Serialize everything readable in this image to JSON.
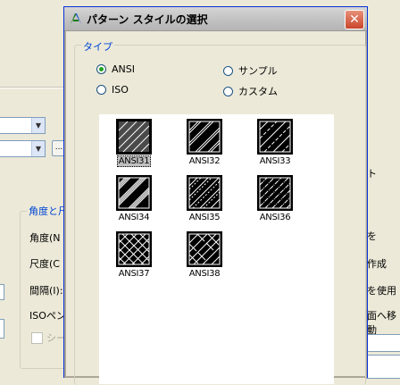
{
  "dialog": {
    "title": "パターン スタイルの選択",
    "close_symbol": "✕",
    "group_label": "タイプ",
    "radios": [
      {
        "label": "ANSI",
        "selected": true
      },
      {
        "label": "ISO",
        "selected": false
      },
      {
        "label": "サンプル",
        "selected": false
      },
      {
        "label": "カスタム",
        "selected": false
      }
    ],
    "patterns": [
      {
        "label": "ANSI31",
        "selected": true
      },
      {
        "label": "ANSI32",
        "selected": false
      },
      {
        "label": "ANSI33",
        "selected": false
      },
      {
        "label": "ANSI34",
        "selected": false
      },
      {
        "label": "ANSI35",
        "selected": false
      },
      {
        "label": "ANSI36",
        "selected": false
      },
      {
        "label": "ANSI37",
        "selected": false
      },
      {
        "label": "ANSI38",
        "selected": false
      }
    ]
  },
  "background": {
    "group_label": "角度と尺",
    "labels": [
      "角度(N",
      "尺度(C",
      "間隔(I):",
      "ISOペン"
    ],
    "checkbox_label": "シー",
    "small_button": "...",
    "right_labels": [
      "ト",
      "を",
      "作成",
      "を使用",
      "面へ移動"
    ]
  },
  "colors": {
    "accent": "#0046d5",
    "radio_selected": "#21a121",
    "close_button": "#c9452a",
    "selection_highlight": "#c0c0c0"
  }
}
